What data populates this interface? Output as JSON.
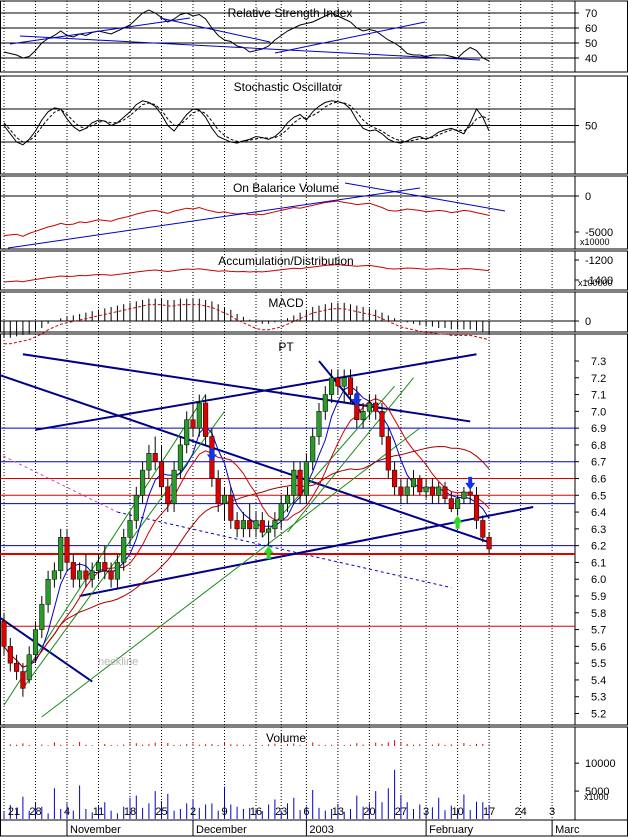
{
  "panels": [
    {
      "id": "rsi",
      "title": "Relative Strength Index",
      "ticks": [
        "70",
        "60",
        "50",
        "40"
      ],
      "multiplier": ""
    },
    {
      "id": "stoch",
      "title": "Stochastic Oscillator",
      "ticks": [
        "50"
      ],
      "multiplier": ""
    },
    {
      "id": "obv",
      "title": "On Balance Volume",
      "ticks": [
        "0",
        "-5000"
      ],
      "multiplier": "x10000"
    },
    {
      "id": "ad",
      "title": "Accumulation/Distribution",
      "ticks": [
        "-1200",
        "-1400"
      ],
      "multiplier": "x100000"
    },
    {
      "id": "macd",
      "title": "MACD",
      "ticks": [
        "0"
      ],
      "multiplier": ""
    },
    {
      "id": "price",
      "title": "PT",
      "ticks": [
        "7.3",
        "7.2",
        "7.1",
        "7.0",
        "6.9",
        "6.8",
        "6.7",
        "6.6",
        "6.5",
        "6.4",
        "6.3",
        "6.2",
        "6.1",
        "6.0",
        "5.9",
        "5.8",
        "5.7",
        "5.6",
        "5.5",
        "5.4",
        "5.3",
        "5.2"
      ],
      "multiplier": ""
    },
    {
      "id": "volume",
      "title": "Volume",
      "ticks": [
        "10000",
        "5000"
      ],
      "multiplier": "x1000"
    }
  ],
  "annotations": {
    "neckline": "neckline"
  },
  "x_axis": {
    "days": [
      "21",
      "28",
      "4",
      "11",
      "18",
      "25",
      "2",
      "9",
      "16",
      "23",
      "6",
      "13",
      "20",
      "27",
      "3",
      "10",
      "17",
      "24",
      "3"
    ],
    "months": [
      "November",
      "December",
      "2003",
      "February",
      "Marc"
    ]
  },
  "colors": {
    "candle_up": "#2a9a2a",
    "candle_down": "#dd0000",
    "channel": "#00008b",
    "trend_green": "#1a8a1a",
    "support": "#dd0000",
    "ma_blue": "#0000cc",
    "ma_red": "#cc0000",
    "volume_bar": "#0000cc"
  },
  "chart_data": {
    "type": "candlestick",
    "x_range": [
      "2002-10-21",
      "2003-03-03"
    ],
    "price_range": [
      5.15,
      7.4
    ],
    "candles": [
      [
        5.75,
        5.8,
        5.55,
        5.6
      ],
      [
        5.6,
        5.65,
        5.45,
        5.5
      ],
      [
        5.5,
        5.55,
        5.4,
        5.45
      ],
      [
        5.45,
        5.5,
        5.3,
        5.35
      ],
      [
        5.4,
        5.6,
        5.38,
        5.55
      ],
      [
        5.55,
        5.75,
        5.5,
        5.7
      ],
      [
        5.7,
        5.9,
        5.65,
        5.85
      ],
      [
        5.85,
        6.05,
        5.8,
        6.0
      ],
      [
        6.0,
        6.1,
        5.95,
        6.05
      ],
      [
        6.05,
        6.3,
        6.0,
        6.25
      ],
      [
        6.25,
        6.3,
        6.05,
        6.1
      ],
      [
        6.1,
        6.15,
        5.95,
        6.0
      ],
      [
        6.0,
        6.1,
        5.95,
        6.05
      ],
      [
        6.05,
        6.15,
        5.95,
        6.0
      ],
      [
        6.0,
        6.1,
        5.95,
        6.05
      ],
      [
        6.05,
        6.15,
        6.0,
        6.1
      ],
      [
        6.1,
        6.2,
        6.0,
        6.05
      ],
      [
        6.05,
        6.1,
        5.95,
        6.0
      ],
      [
        6.0,
        6.15,
        5.95,
        6.1
      ],
      [
        6.1,
        6.3,
        6.05,
        6.25
      ],
      [
        6.25,
        6.4,
        6.2,
        6.35
      ],
      [
        6.35,
        6.55,
        6.3,
        6.5
      ],
      [
        6.5,
        6.7,
        6.45,
        6.65
      ],
      [
        6.65,
        6.8,
        6.6,
        6.75
      ],
      [
        6.75,
        6.85,
        6.65,
        6.7
      ],
      [
        6.7,
        6.8,
        6.5,
        6.55
      ],
      [
        6.55,
        6.6,
        6.4,
        6.45
      ],
      [
        6.45,
        6.7,
        6.4,
        6.65
      ],
      [
        6.65,
        6.85,
        6.6,
        6.8
      ],
      [
        6.8,
        7.0,
        6.75,
        6.95
      ],
      [
        6.95,
        7.05,
        6.85,
        6.9
      ],
      [
        6.9,
        7.1,
        6.85,
        7.05
      ],
      [
        7.05,
        7.1,
        6.8,
        6.85
      ],
      [
        6.85,
        6.9,
        6.55,
        6.6
      ],
      [
        6.6,
        6.65,
        6.4,
        6.45
      ],
      [
        6.45,
        6.55,
        6.35,
        6.5
      ],
      [
        6.5,
        6.55,
        6.3,
        6.35
      ],
      [
        6.35,
        6.4,
        6.25,
        6.3
      ],
      [
        6.3,
        6.4,
        6.25,
        6.35
      ],
      [
        6.35,
        6.45,
        6.25,
        6.3
      ],
      [
        6.3,
        6.4,
        6.25,
        6.35
      ],
      [
        6.35,
        6.4,
        6.25,
        6.28
      ],
      [
        6.28,
        6.35,
        6.2,
        6.3
      ],
      [
        6.3,
        6.4,
        6.25,
        6.35
      ],
      [
        6.35,
        6.5,
        6.3,
        6.45
      ],
      [
        6.45,
        6.55,
        6.4,
        6.5
      ],
      [
        6.5,
        6.7,
        6.45,
        6.65
      ],
      [
        6.65,
        6.7,
        6.45,
        6.5
      ],
      [
        6.5,
        6.75,
        6.45,
        6.7
      ],
      [
        6.7,
        6.9,
        6.65,
        6.85
      ],
      [
        6.85,
        7.05,
        6.8,
        7.0
      ],
      [
        7.0,
        7.15,
        6.95,
        7.1
      ],
      [
        7.1,
        7.25,
        7.05,
        7.2
      ],
      [
        7.2,
        7.25,
        7.1,
        7.15
      ],
      [
        7.15,
        7.25,
        7.05,
        7.2
      ],
      [
        7.2,
        7.25,
        7.05,
        7.1
      ],
      [
        7.1,
        7.15,
        6.9,
        6.95
      ],
      [
        6.95,
        7.05,
        6.9,
        7.0
      ],
      [
        7.0,
        7.1,
        6.95,
        7.05
      ],
      [
        7.05,
        7.1,
        6.95,
        7.0
      ],
      [
        7.0,
        7.05,
        6.8,
        6.85
      ],
      [
        6.85,
        6.9,
        6.6,
        6.65
      ],
      [
        6.65,
        6.7,
        6.5,
        6.55
      ],
      [
        6.55,
        6.6,
        6.45,
        6.5
      ],
      [
        6.5,
        6.6,
        6.45,
        6.55
      ],
      [
        6.55,
        6.65,
        6.5,
        6.6
      ],
      [
        6.6,
        6.62,
        6.5,
        6.52
      ],
      [
        6.52,
        6.6,
        6.48,
        6.55
      ],
      [
        6.55,
        6.6,
        6.45,
        6.5
      ],
      [
        6.5,
        6.58,
        6.45,
        6.55
      ],
      [
        6.55,
        6.58,
        6.45,
        6.48
      ],
      [
        6.48,
        6.52,
        6.4,
        6.42
      ],
      [
        6.42,
        6.5,
        6.38,
        6.48
      ],
      [
        6.48,
        6.55,
        6.45,
        6.52
      ],
      [
        6.52,
        6.56,
        6.45,
        6.5
      ],
      [
        6.5,
        6.55,
        6.3,
        6.35
      ],
      [
        6.35,
        6.38,
        6.22,
        6.25
      ],
      [
        6.25,
        6.28,
        6.15,
        6.18
      ]
    ],
    "volumes": [
      1200,
      2500,
      1800,
      4000,
      1500,
      3000,
      2200,
      1000,
      5500,
      1800,
      2800,
      1500,
      6000,
      1800,
      1200,
      2500,
      3000,
      1500,
      1000,
      2200,
      3800,
      4200,
      2000,
      2800,
      5000,
      3200,
      4500,
      1500,
      1800,
      2800,
      3500,
      2000,
      2600,
      2800,
      1500,
      5800,
      2600,
      2200,
      1800,
      2000,
      1700,
      1400,
      2600,
      3500,
      1500,
      2800,
      3800,
      1600,
      2200,
      5200,
      2000,
      1500,
      1800,
      2700,
      1300,
      1800,
      4200,
      2200,
      2800,
      5000,
      3000,
      5500,
      8800,
      4300,
      3000,
      1800,
      2600,
      1500,
      2100,
      3800,
      1600,
      2400,
      1800,
      4400,
      1600,
      3100,
      3000,
      2500
    ],
    "rsi": [
      44,
      43,
      42,
      40,
      41,
      45,
      50,
      53,
      55,
      58,
      55,
      54,
      56,
      55,
      57,
      58,
      57,
      56,
      58,
      60,
      62,
      66,
      70,
      72,
      70,
      67,
      64,
      66,
      69,
      70,
      68,
      69,
      66,
      60,
      55,
      52,
      51,
      48,
      47,
      44,
      45,
      46,
      48,
      52,
      55,
      58,
      60,
      62,
      63,
      64,
      66,
      68,
      70,
      68,
      66,
      64,
      60,
      58,
      59,
      58,
      55,
      52,
      50,
      47,
      43,
      42,
      42,
      41,
      42,
      42,
      42,
      41,
      40,
      44,
      47,
      45,
      40,
      38
    ],
    "stoch": [
      [
        50,
        35,
        20,
        15,
        25,
        40,
        60,
        75,
        82,
        80,
        62,
        48,
        40,
        45,
        55,
        60,
        58,
        50,
        55,
        65,
        75,
        88,
        95,
        92,
        85,
        70,
        50,
        40,
        55,
        70,
        80,
        78,
        65,
        45,
        30,
        25,
        20,
        18,
        22,
        25,
        30,
        28,
        25,
        30,
        40,
        55,
        65,
        70,
        60,
        75,
        85,
        92,
        95,
        93,
        90,
        80,
        60,
        45,
        40,
        42,
        35,
        25,
        20,
        18,
        22,
        28,
        30,
        25,
        30,
        38,
        42,
        45,
        40,
        35,
        55,
        80,
        65,
        40
      ],
      [
        55,
        42,
        28,
        20,
        22,
        32,
        48,
        62,
        74,
        79,
        70,
        58,
        48,
        45,
        50,
        56,
        58,
        55,
        55,
        60,
        68,
        78,
        88,
        91,
        88,
        78,
        62,
        50,
        52,
        62,
        73,
        77,
        72,
        58,
        42,
        32,
        25,
        21,
        21,
        23,
        26,
        28,
        27,
        28,
        33,
        43,
        55,
        63,
        64,
        68,
        75,
        84,
        90,
        93,
        91,
        86,
        74,
        60,
        50,
        45,
        40,
        32,
        26,
        22,
        21,
        23,
        26,
        27,
        28,
        33,
        38,
        42,
        42,
        40,
        48,
        62,
        67,
        60
      ]
    ],
    "obv": [
      -5500,
      -5400,
      -5300,
      -5600,
      -5200,
      -4900,
      -4600,
      -4300,
      -4100,
      -3800,
      -4000,
      -3900,
      -3600,
      -3700,
      -3500,
      -3300,
      -3400,
      -3500,
      -3200,
      -3000,
      -2800,
      -2500,
      -2300,
      -2100,
      -2000,
      -2200,
      -2400,
      -2100,
      -1900,
      -1700,
      -1800,
      -1600,
      -1900,
      -2100,
      -2300,
      -2200,
      -2400,
      -2500,
      -2400,
      -2600,
      -2500,
      -2600,
      -2400,
      -2200,
      -2000,
      -1800,
      -1600,
      -1700,
      -1500,
      -1300,
      -1100,
      -900,
      -800,
      -700,
      -900,
      -1000,
      -1200,
      -1100,
      -1000,
      -1300,
      -1600,
      -2000,
      -2100,
      -2000,
      -1800,
      -1900,
      -2000,
      -2200,
      -2100,
      -2000,
      -2100,
      -2300,
      -2200,
      -2000,
      -2100,
      -2300,
      -2500,
      -2700
    ],
    "ad": [
      -1420,
      -1415,
      -1410,
      -1418,
      -1405,
      -1395,
      -1385,
      -1375,
      -1370,
      -1360,
      -1365,
      -1362,
      -1355,
      -1358,
      -1350,
      -1345,
      -1348,
      -1352,
      -1345,
      -1338,
      -1330,
      -1320,
      -1312,
      -1305,
      -1300,
      -1308,
      -1315,
      -1306,
      -1298,
      -1290,
      -1294,
      -1288,
      -1296,
      -1304,
      -1312,
      -1308,
      -1314,
      -1318,
      -1315,
      -1320,
      -1316,
      -1319,
      -1312,
      -1305,
      -1298,
      -1290,
      -1282,
      -1286,
      -1278,
      -1270,
      -1262,
      -1254,
      -1250,
      -1246,
      -1252,
      -1256,
      -1262,
      -1258,
      -1254,
      -1264,
      -1274,
      -1286,
      -1290,
      -1286,
      -1280,
      -1283,
      -1287,
      -1293,
      -1290,
      -1286,
      -1289,
      -1295,
      -1292,
      -1286,
      -1288,
      -1294,
      -1300,
      -1306
    ],
    "macd": [
      -0.12,
      -0.12,
      -0.11,
      -0.1,
      -0.09,
      -0.07,
      -0.05,
      -0.02,
      0.0,
      0.02,
      0.03,
      0.04,
      0.05,
      0.06,
      0.07,
      0.08,
      0.09,
      0.1,
      0.11,
      0.12,
      0.13,
      0.14,
      0.15,
      0.16,
      0.16,
      0.16,
      0.15,
      0.15,
      0.16,
      0.16,
      0.16,
      0.16,
      0.15,
      0.14,
      0.12,
      0.1,
      0.08,
      0.05,
      0.03,
      0.01,
      -0.01,
      -0.02,
      -0.02,
      -0.01,
      0.0,
      0.02,
      0.04,
      0.06,
      0.08,
      0.1,
      0.11,
      0.12,
      0.13,
      0.13,
      0.13,
      0.12,
      0.11,
      0.1,
      0.09,
      0.08,
      0.06,
      0.04,
      0.02,
      0.0,
      -0.01,
      -0.02,
      -0.03,
      -0.04,
      -0.04,
      -0.05,
      -0.05,
      -0.06,
      -0.06,
      -0.06,
      -0.06,
      -0.07,
      -0.08,
      -0.09
    ],
    "horizontal_levels": {
      "blue": [
        6.9,
        6.7,
        6.45,
        6.2
      ],
      "red": [
        6.6,
        6.5,
        6.15,
        5.72
      ]
    },
    "trendlines": [
      {
        "name": "upper-channel",
        "color": "#00008b",
        "points": [
          [
            3,
            7.34
          ],
          [
            74,
            6.94
          ]
        ]
      },
      {
        "name": "long-downtrend",
        "color": "#00008b",
        "points": [
          [
            -1,
            7.22
          ],
          [
            77,
            6.22
          ]
        ]
      },
      {
        "name": "lower-support",
        "color": "#00008b",
        "points": [
          [
            12,
            5.9
          ],
          [
            84,
            6.43
          ]
        ]
      },
      {
        "name": "short-downtrend",
        "color": "#00008b",
        "points": [
          [
            -1,
            5.78
          ],
          [
            14,
            5.39
          ]
        ]
      },
      {
        "name": "top-channel",
        "color": "#00008b",
        "points": [
          [
            5,
            6.89
          ],
          [
            75,
            7.34
          ]
        ]
      },
      {
        "name": "steep-rise",
        "color": "#00008b",
        "points": [
          [
            50,
            7.3
          ],
          [
            57,
            6.98
          ]
        ]
      },
      {
        "name": "green-long",
        "color": "#1a8a1a",
        "points": [
          [
            6,
            5.18
          ],
          [
            66,
            6.9
          ]
        ]
      },
      {
        "name": "green-up-1",
        "color": "#1a8a1a",
        "points": [
          [
            0,
            5.25
          ],
          [
            32,
            7.1
          ]
        ]
      },
      {
        "name": "green-up-2",
        "color": "#1a8a1a",
        "points": [
          [
            3,
            5.35
          ],
          [
            35,
            7.0
          ]
        ]
      },
      {
        "name": "green-up-3",
        "color": "#1a8a1a",
        "points": [
          [
            41,
            6.25
          ],
          [
            62,
            7.15
          ]
        ]
      },
      {
        "name": "green-fall",
        "color": "#1a8a1a",
        "points": [
          [
            45,
            6.28
          ],
          [
            65,
            7.2
          ]
        ]
      },
      {
        "name": "pink-neckline",
        "color": "#cc44cc",
        "points": [
          [
            -1,
            6.75
          ],
          [
            18,
            6.4
          ]
        ]
      },
      {
        "name": "blue-dash",
        "color": "#0000cc",
        "points": [
          [
            18,
            6.4
          ],
          [
            71,
            5.95
          ]
        ]
      }
    ],
    "signals": [
      {
        "i": 33,
        "price": 6.72,
        "type": "sell"
      },
      {
        "i": 42,
        "price": 6.18,
        "type": "buy"
      },
      {
        "i": 56,
        "price": 7.05,
        "type": "sell"
      },
      {
        "i": 72,
        "price": 6.36,
        "type": "buy"
      },
      {
        "i": 74,
        "price": 6.55,
        "type": "sell"
      }
    ]
  }
}
